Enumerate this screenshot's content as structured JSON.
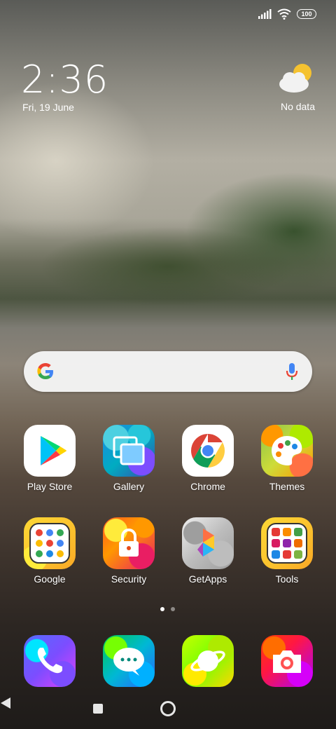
{
  "status_bar": {
    "battery": "100",
    "signal_icon": "signal-icon",
    "wifi_icon": "wifi-icon"
  },
  "clock": {
    "time": "2:36",
    "date": "Fri, 19 June"
  },
  "weather": {
    "icon": "partly-cloudy-icon",
    "text": "No data"
  },
  "search_bar": {
    "logo": "google-g-icon",
    "mic": "microphone-icon"
  },
  "apps_row1": [
    {
      "label": "Play Store",
      "icon": "play-store-icon"
    },
    {
      "label": "Gallery",
      "icon": "gallery-icon"
    },
    {
      "label": "Chrome",
      "icon": "chrome-icon"
    },
    {
      "label": "Themes",
      "icon": "themes-icon"
    }
  ],
  "apps_row2": [
    {
      "label": "Google",
      "icon": "google-folder-icon"
    },
    {
      "label": "Security",
      "icon": "security-icon"
    },
    {
      "label": "GetApps",
      "icon": "getapps-icon"
    },
    {
      "label": "Tools",
      "icon": "tools-folder-icon"
    }
  ],
  "dock": [
    {
      "icon": "phone-icon"
    },
    {
      "icon": "messages-icon"
    },
    {
      "icon": "browser-icon"
    },
    {
      "icon": "camera-icon"
    }
  ],
  "page_indicator": {
    "current": 1,
    "total": 2
  },
  "nav_bar": {
    "recents": "recents-icon",
    "home": "home-icon",
    "back": "back-icon"
  }
}
